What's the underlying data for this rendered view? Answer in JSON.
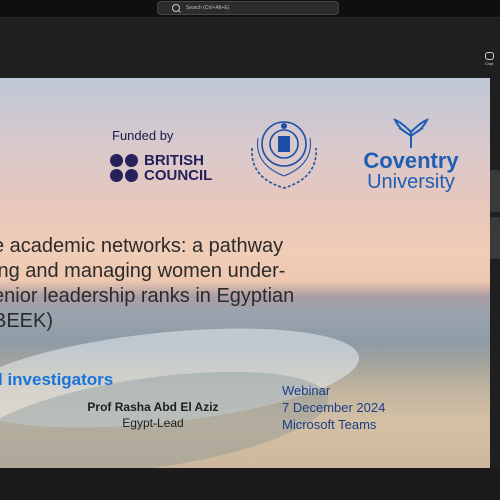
{
  "app": {
    "search_placeholder": "Search (Ctrl+Alt+E)",
    "chat_label": "Chat"
  },
  "slide": {
    "funded_by": "Funded by",
    "british_council": [
      "BRITISH",
      "COUNCIL"
    ],
    "coventry": [
      "Coventry",
      "University"
    ],
    "title_lines": [
      "e academic networks: a pathway",
      "ing and managing women under-",
      "enior leadership ranks in Egyptian",
      "BEEK)"
    ],
    "investigators_heading": "l investigators",
    "investigator_name": "Prof Rasha Abd El Aziz",
    "investigator_role": "Egypt-Lead",
    "webinar": [
      "Webinar",
      "7 December 2024",
      "Microsoft Teams"
    ]
  },
  "colors": {
    "accent": "#1a73d8",
    "bc_navy": "#24215b",
    "coventry_blue": "#1f5eb4",
    "webinar_navy": "#1b3d86"
  },
  "icons": [
    "search-icon",
    "chat-icon",
    "british-council-dots-icon",
    "aast-emblem-icon",
    "coventry-phoenix-icon"
  ]
}
